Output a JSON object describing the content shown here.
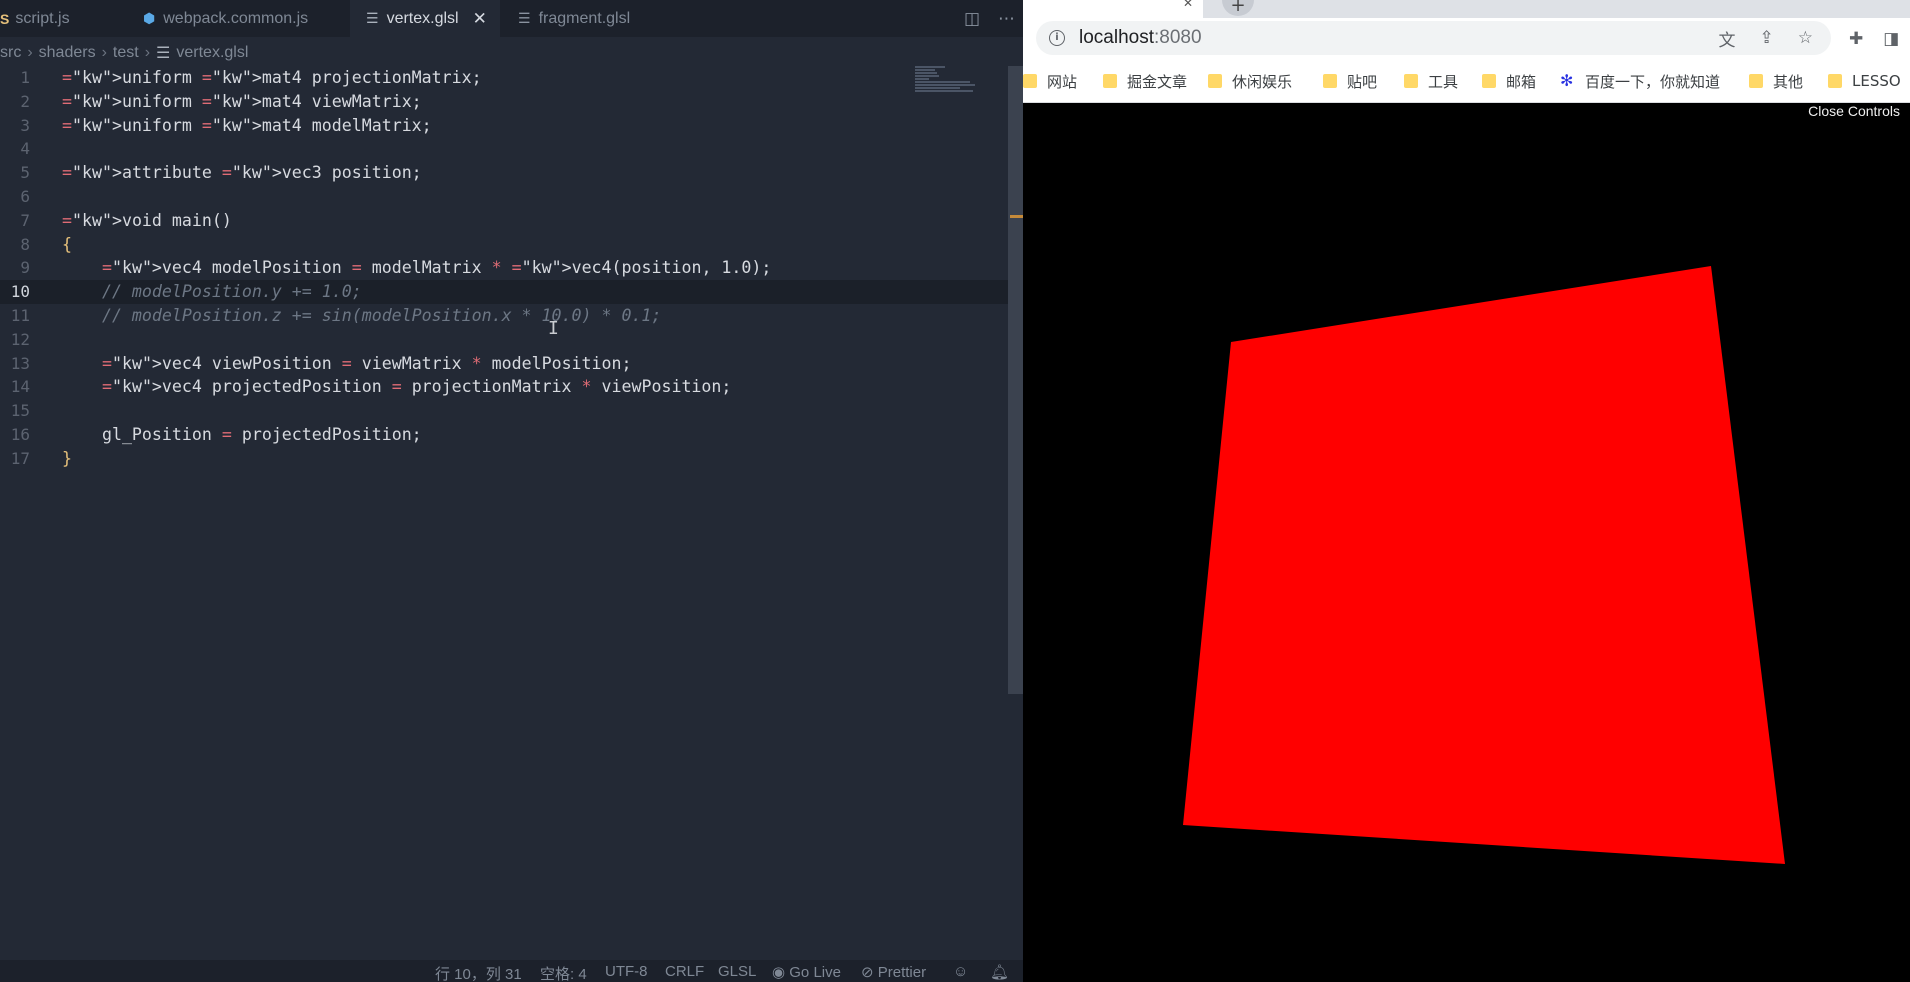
{
  "editor": {
    "tabs": [
      {
        "label": "script.js",
        "icon": "js-icon"
      },
      {
        "label": "webpack.common.js",
        "icon": "webpack-icon"
      },
      {
        "label": "vertex.glsl",
        "icon": "file-lines-icon",
        "active": true
      },
      {
        "label": "fragment.glsl",
        "icon": "file-lines-icon"
      }
    ],
    "breadcrumb": [
      "src",
      "shaders",
      "test",
      "vertex.glsl"
    ],
    "lines": [
      {
        "n": "1",
        "text": "uniform mat4 projectionMatrix;"
      },
      {
        "n": "2",
        "text": "uniform mat4 viewMatrix;"
      },
      {
        "n": "3",
        "text": "uniform mat4 modelMatrix;"
      },
      {
        "n": "4",
        "text": ""
      },
      {
        "n": "5",
        "text": "attribute vec3 position;"
      },
      {
        "n": "6",
        "text": ""
      },
      {
        "n": "7",
        "text": "void main()"
      },
      {
        "n": "8",
        "text": "{"
      },
      {
        "n": "9",
        "text": "    vec4 modelPosition = modelMatrix * vec4(position, 1.0);"
      },
      {
        "n": "10",
        "text": "    // modelPosition.y += 1.0;"
      },
      {
        "n": "11",
        "text": "    // modelPosition.z += sin(modelPosition.x * 10.0) * 0.1;"
      },
      {
        "n": "12",
        "text": ""
      },
      {
        "n": "13",
        "text": "    vec4 viewPosition = viewMatrix * modelPosition;"
      },
      {
        "n": "14",
        "text": "    vec4 projectedPosition = projectionMatrix * viewPosition;"
      },
      {
        "n": "15",
        "text": ""
      },
      {
        "n": "16",
        "text": "    gl_Position = projectedPosition;"
      },
      {
        "n": "17",
        "text": "}"
      }
    ],
    "current_line": "10",
    "status": {
      "position": "行 10，列 31",
      "spaces": "空格: 4",
      "encoding": "UTF-8",
      "eol": "CRLF",
      "language": "GLSL",
      "go_live": "Go Live",
      "prettier": "Prettier"
    }
  },
  "browser": {
    "url_host": "localhost",
    "url_port": ":8080",
    "bookmarks": [
      {
        "label": "网站",
        "icon": "folder-icon"
      },
      {
        "label": "掘金文章",
        "icon": "folder-icon"
      },
      {
        "label": "休闲娱乐",
        "icon": "folder-icon"
      },
      {
        "label": "贴吧",
        "icon": "folder-icon"
      },
      {
        "label": "工具",
        "icon": "folder-icon"
      },
      {
        "label": "邮箱",
        "icon": "folder-icon"
      },
      {
        "label": "百度一下，你就知道",
        "icon": "baidu-paw-icon"
      },
      {
        "label": "其他",
        "icon": "folder-icon"
      },
      {
        "label": "LESSO",
        "icon": "folder-icon"
      }
    ],
    "controls_label": "Close Controls",
    "scene": {
      "background": "#000000",
      "plane_color": "#ff0000"
    }
  }
}
